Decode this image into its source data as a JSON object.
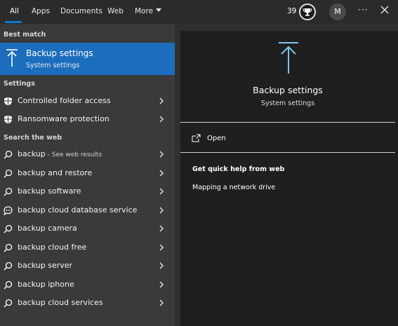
{
  "tabs": [
    {
      "label": "All"
    },
    {
      "label": "Apps"
    },
    {
      "label": "Documents"
    },
    {
      "label": "Web"
    },
    {
      "label": "More"
    }
  ],
  "header": {
    "points": "39",
    "avatar_initial": "M",
    "more_label": "···"
  },
  "left": {
    "best_match_header": "Best match",
    "best_match": {
      "title": "Backup settings",
      "subtitle": "System settings"
    },
    "settings_header": "Settings",
    "settings_items": [
      {
        "label": "Controlled folder access",
        "icon": "shield-icon"
      },
      {
        "label": "Ransomware protection",
        "icon": "shield-icon"
      }
    ],
    "web_header": "Search the web",
    "web_items": [
      {
        "label": "backup",
        "hint": " - See web results",
        "icon": "search-icon"
      },
      {
        "label": "backup and restore",
        "icon": "search-icon"
      },
      {
        "label": "backup software",
        "icon": "search-icon"
      },
      {
        "label": "backup cloud database service",
        "icon": "chat-icon"
      },
      {
        "label": "backup camera",
        "icon": "search-icon"
      },
      {
        "label": "backup cloud free",
        "icon": "search-icon"
      },
      {
        "label": "backup server",
        "icon": "search-icon"
      },
      {
        "label": "backup iphone",
        "icon": "search-icon"
      },
      {
        "label": "backup cloud services",
        "icon": "search-icon"
      }
    ]
  },
  "right": {
    "title": "Backup settings",
    "subtitle": "System settings",
    "open_label": "Open",
    "help_title": "Get quick help from web",
    "help_links": [
      "Mapping a network drive"
    ]
  },
  "colors": {
    "accent": "#0078d7",
    "selection": "#1c6dbe",
    "icon_blue": "#7fc7f0"
  }
}
